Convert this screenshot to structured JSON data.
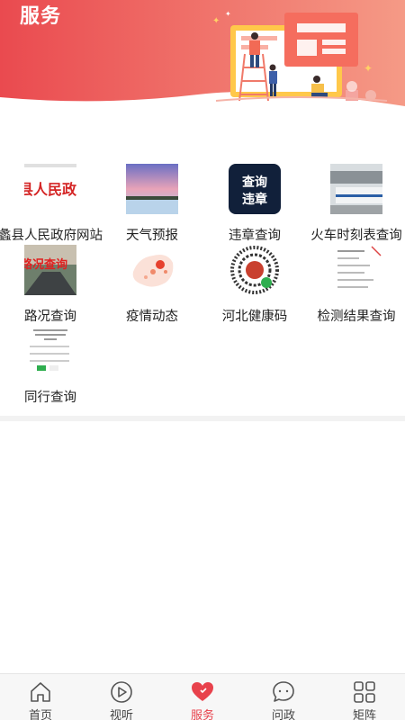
{
  "header": {
    "title": "服务",
    "accent": "#eb4a4e"
  },
  "services": [
    {
      "label": "蠡县人民政府网站",
      "thumb_text": "县人民政"
    },
    {
      "label": "天气预报"
    },
    {
      "label": "违章查询",
      "thumb_text": "查询违章"
    },
    {
      "label": "火车时刻表查询"
    },
    {
      "label": "路况查询",
      "thumb_text": "路况查询"
    },
    {
      "label": "疫情动态"
    },
    {
      "label": "河北健康码"
    },
    {
      "label": "检测结果查询"
    },
    {
      "label": "同行查询"
    }
  ],
  "tabbar": {
    "items": [
      {
        "label": "首页",
        "icon": "home-icon"
      },
      {
        "label": "视听",
        "icon": "play-icon"
      },
      {
        "label": "服务",
        "icon": "heart-icon",
        "active": true
      },
      {
        "label": "问政",
        "icon": "chat-icon"
      },
      {
        "label": "矩阵",
        "icon": "grid-icon"
      }
    ],
    "active_color": "#e8424c"
  }
}
